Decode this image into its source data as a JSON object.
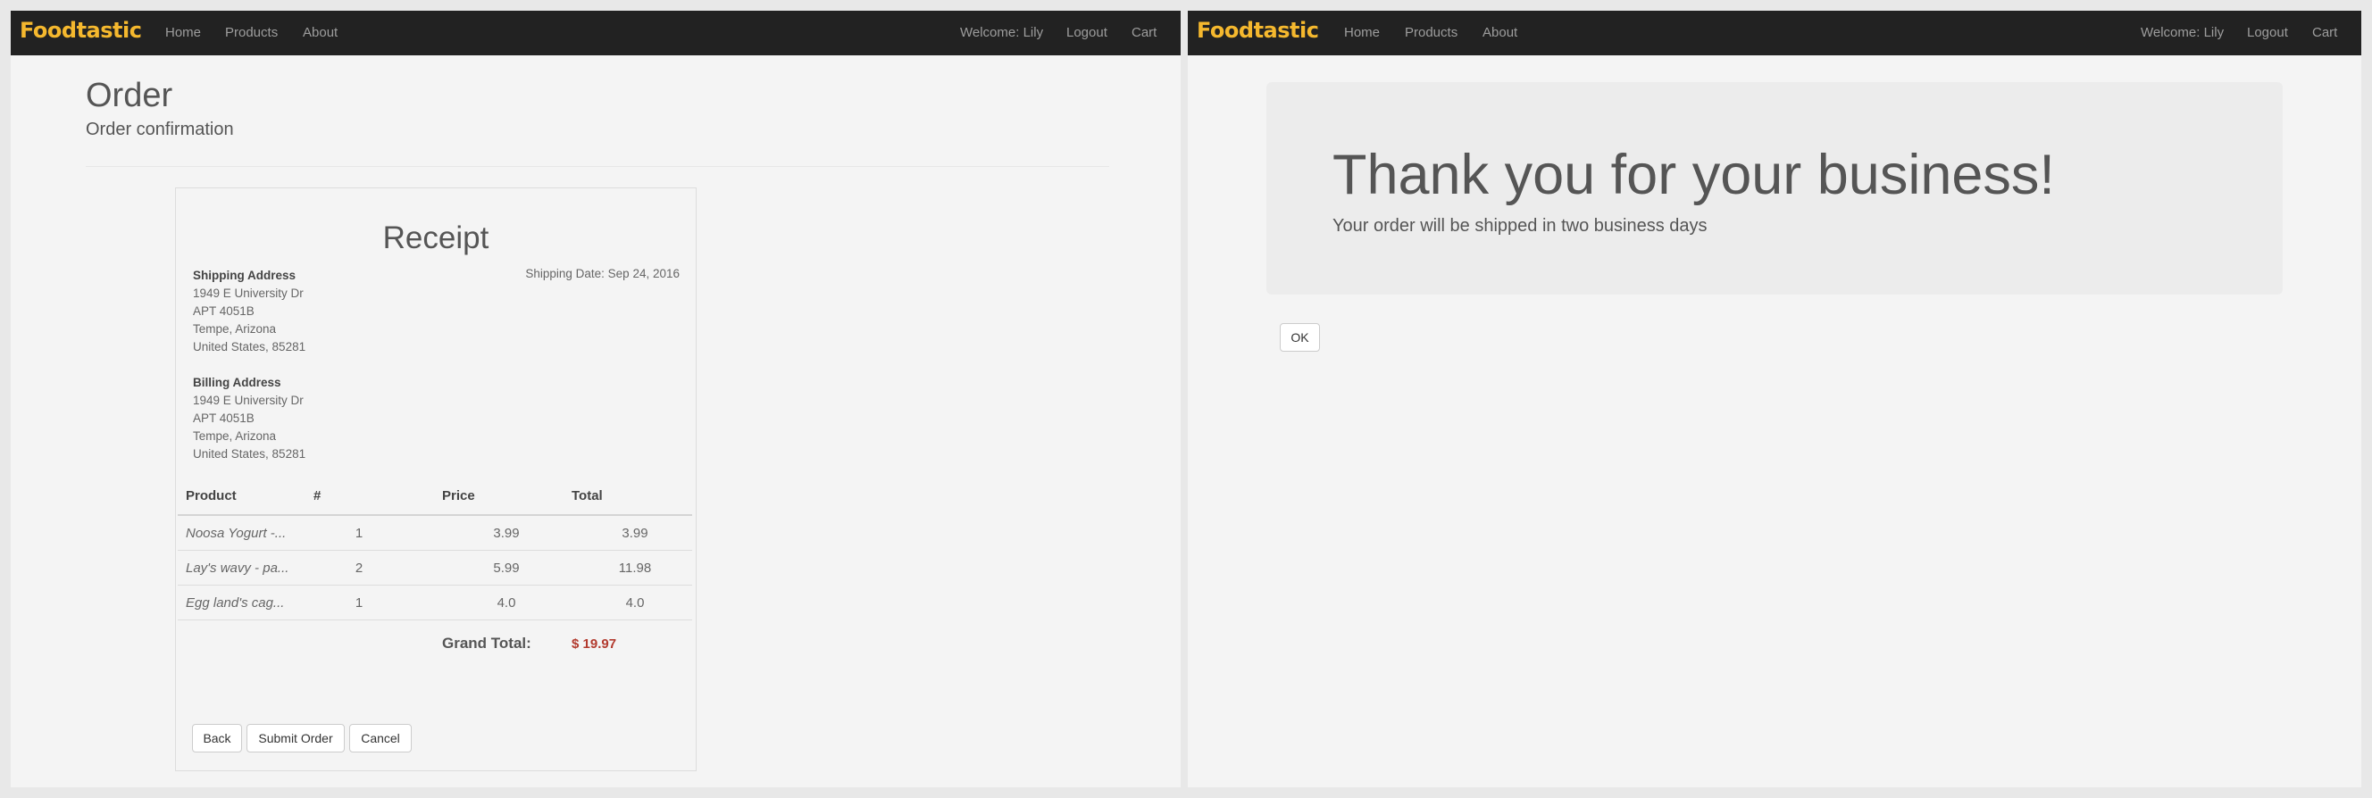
{
  "left_window": {
    "navbar": {
      "brand": "Foodtastic",
      "links": [
        "Home",
        "Products",
        "About"
      ],
      "welcome": "Welcome: Lily",
      "logout": "Logout",
      "cart": "Cart"
    },
    "page": {
      "title": "Order",
      "subtitle": "Order confirmation"
    },
    "receipt": {
      "title": "Receipt",
      "shipping_date": "Shipping Date: Sep 24, 2016",
      "shipping_address": {
        "heading": "Shipping Address",
        "line1": "1949 E University Dr",
        "line2": "APT 4051B",
        "line3": "Tempe, Arizona",
        "line4": "United States, 85281"
      },
      "billing_address": {
        "heading": "Billing Address",
        "line1": "1949 E University Dr",
        "line2": "APT 4051B",
        "line3": "Tempe, Arizona",
        "line4": "United States, 85281"
      },
      "table": {
        "headers": {
          "product": "Product",
          "qty": "#",
          "price": "Price",
          "total": "Total"
        },
        "rows": [
          {
            "product": "Noosa Yogurt -...",
            "qty": "1",
            "price": "3.99",
            "total": "3.99"
          },
          {
            "product": "Lay's wavy - pa...",
            "qty": "2",
            "price": "5.99",
            "total": "11.98"
          },
          {
            "product": "Egg land's cag...",
            "qty": "1",
            "price": "4.0",
            "total": "4.0"
          }
        ]
      },
      "grand_total_label": "Grand Total:",
      "grand_total_value": "$ 19.97",
      "buttons": {
        "back": "Back",
        "submit": "Submit Order",
        "cancel": "Cancel"
      }
    }
  },
  "right_window": {
    "navbar": {
      "brand": "Foodtastic",
      "links": [
        "Home",
        "Products",
        "About"
      ],
      "welcome": "Welcome: Lily",
      "logout": "Logout",
      "cart": "Cart"
    },
    "jumbotron": {
      "title": "Thank you for your business!",
      "text": "Your order will be shipped in two business days"
    },
    "ok_button": "OK"
  },
  "colors": {
    "navbar_bg": "#222222",
    "brand": "#f5b82e",
    "nav_link": "#9d9d9d",
    "grand_total": "#b23a2e"
  }
}
